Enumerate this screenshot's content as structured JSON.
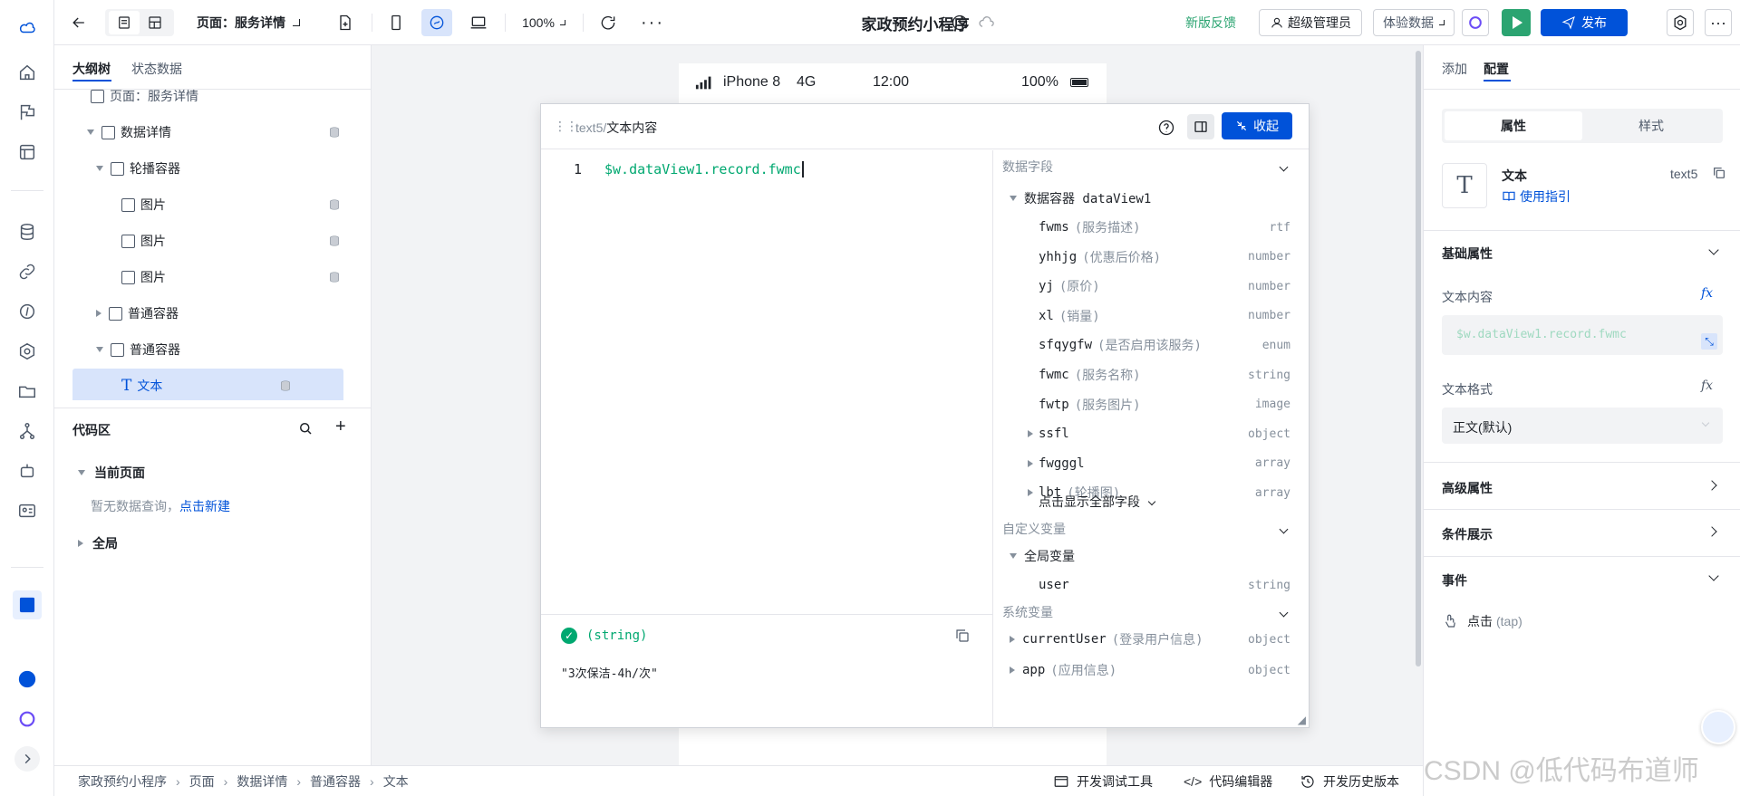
{
  "app": {
    "title": "家政预约小程序"
  },
  "topbar": {
    "page_selector": "页面：服务详情",
    "zoom": "100%",
    "feedback": "新版反馈",
    "admin_label": "超级管理员",
    "data_env": "体验数据",
    "publish": "发布"
  },
  "outline": {
    "tabs": [
      "大纲树",
      "状态数据"
    ],
    "partial_row": "页面：服务详情",
    "items": [
      {
        "label": "数据详情"
      },
      {
        "label": "轮播容器"
      },
      {
        "label": "图片"
      },
      {
        "label": "图片"
      },
      {
        "label": "图片"
      },
      {
        "label": "普通容器"
      },
      {
        "label": "普通容器"
      },
      {
        "label": "文本"
      }
    ],
    "code_area": {
      "title": "代码区",
      "current_page": "当前页面",
      "empty_text": "暂无数据查询，",
      "create_link": "点击新建",
      "global": "全局"
    }
  },
  "phone": {
    "device": "iPhone 8",
    "network": "4G",
    "time": "12:00",
    "battery": "100%"
  },
  "editor": {
    "breadcrumb_id": "text5",
    "breadcrumb_sep": "/",
    "breadcrumb_title": "文本内容",
    "collapse": "收起",
    "line_number": "1",
    "code": "$w.dataView1.record.fwmc",
    "result_type": "(string)",
    "result_value": "\"3次保洁-4h/次\"",
    "fields_section": "数据字段",
    "data_container": "数据容器 dataView1",
    "fields": [
      {
        "name": "fwms",
        "cn": "(服务描述)",
        "type": "rtf"
      },
      {
        "name": "yhhjg",
        "cn": "(优惠后价格)",
        "type": "number"
      },
      {
        "name": "yj",
        "cn": "(原价)",
        "type": "number"
      },
      {
        "name": "xl",
        "cn": "(销量)",
        "type": "number"
      },
      {
        "name": "sfqygfw",
        "cn": "(是否启用该服务)",
        "type": "enum"
      },
      {
        "name": "fwmc",
        "cn": "(服务名称)",
        "type": "string"
      },
      {
        "name": "fwtp",
        "cn": "(服务图片)",
        "type": "image"
      },
      {
        "name": "ssfl",
        "cn": "",
        "type": "object"
      },
      {
        "name": "fwgggl",
        "cn": "",
        "type": "array"
      },
      {
        "name": "lbt",
        "cn": "(轮播图)",
        "type": "array"
      }
    ],
    "show_all": "点击显示全部字段",
    "custom_section": "自定义变量",
    "global_vars": "全局变量",
    "user_var": {
      "name": "user",
      "type": "string"
    },
    "system_section": "系统变量",
    "system_vars": [
      {
        "name": "currentUser",
        "cn": "(登录用户信息)",
        "type": "object"
      },
      {
        "name": "app",
        "cn": "(应用信息)",
        "type": "object"
      }
    ]
  },
  "rpanel": {
    "tabs": [
      "添加",
      "配置"
    ],
    "seg": [
      "属性",
      "样式"
    ],
    "component_name": "文本",
    "component_id": "text5",
    "guide": "使用指引",
    "basic": "基础属性",
    "text_content_label": "文本内容",
    "text_content_value": "$w.dataView1.record.fwmc",
    "text_format_label": "文本格式",
    "text_format_value": "正文(默认)",
    "advanced": "高级属性",
    "condition": "条件展示",
    "events": "事件",
    "event_item": "点击",
    "event_sub": "(tap)",
    "fx": "fx"
  },
  "bottombar": {
    "crumbs": [
      "家政预约小程序",
      "页面",
      "数据详情",
      "普通容器",
      "文本"
    ],
    "devtools": "开发调试工具",
    "code_editor": "代码编辑器",
    "history": "开发历史版本"
  },
  "watermark": "CSDN @低代码布道师",
  "colors": {
    "accent": "#0052d9",
    "code_green": "#00a870",
    "publish_green": "#2ba471",
    "selected_bg": "#d8e4fb"
  }
}
